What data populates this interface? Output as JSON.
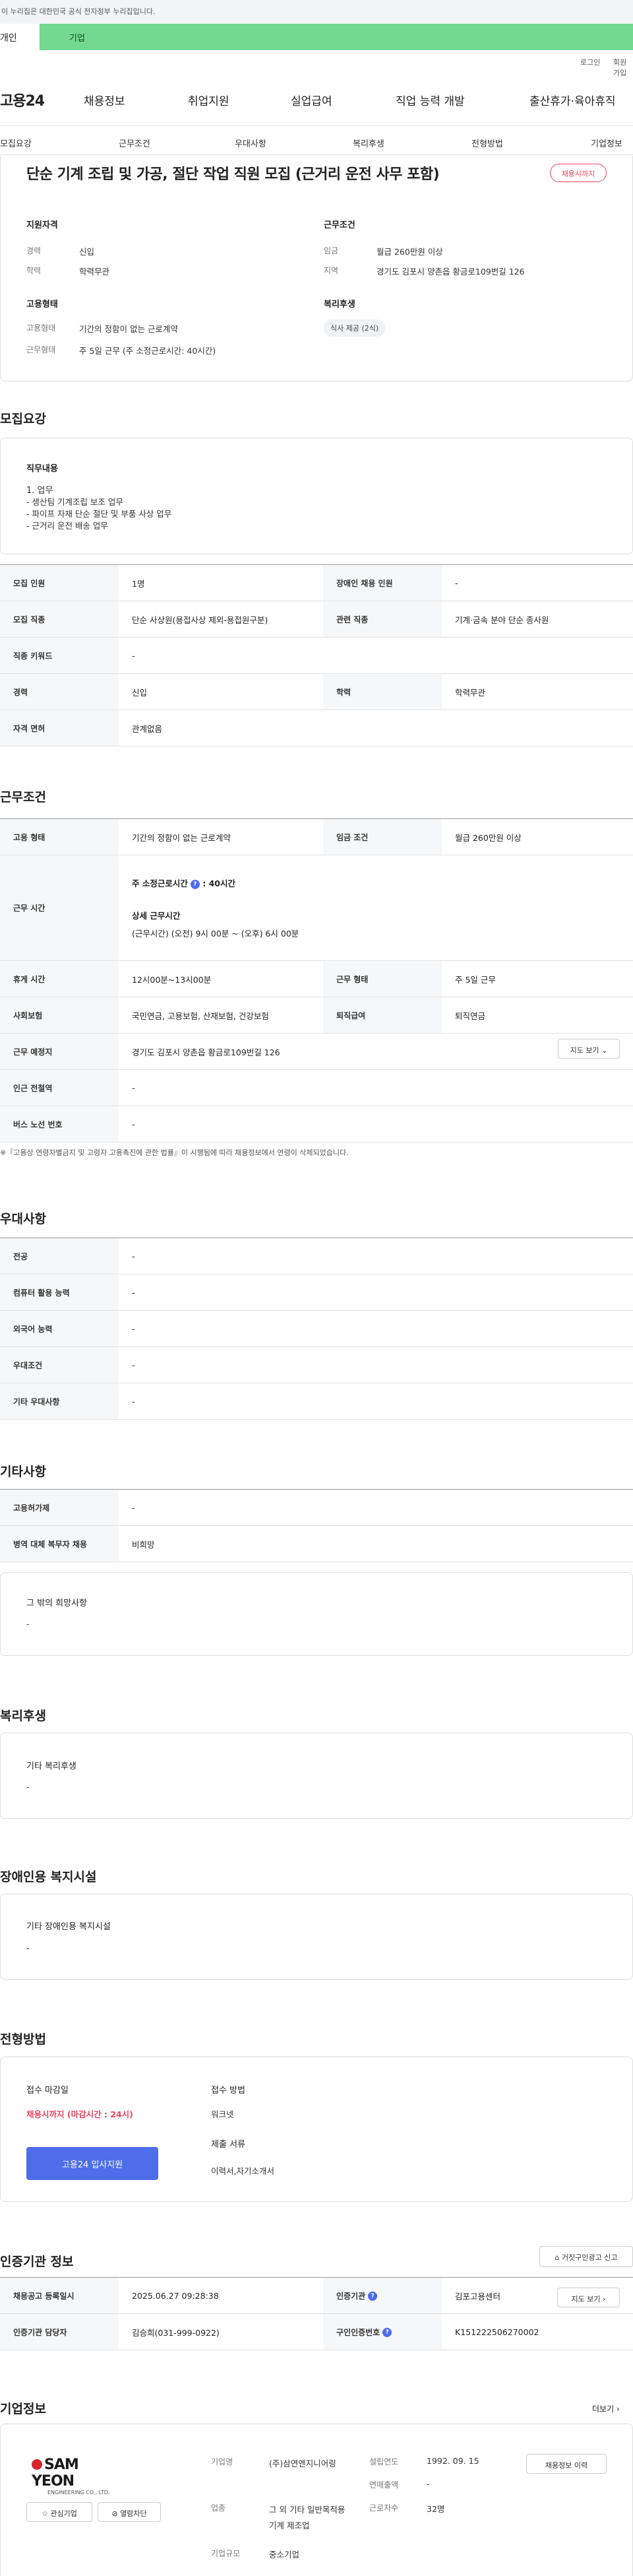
{
  "gov_banner": "이 누리집은 대한민국 공식 전자정부 누리집입니다.",
  "gov_bar": {
    "left": "개인",
    "right": "기업"
  },
  "util": {
    "login": "로그인",
    "join": "회원가입"
  },
  "logo": "고용24",
  "gnb": [
    "채용정보",
    "취업지원",
    "실업급여",
    "직업 능력 개발",
    "출산휴가·육아휴직"
  ],
  "subnav": [
    "모집요강",
    "근무조건",
    "우대사항",
    "복리후생",
    "전형방법",
    "기업정보"
  ],
  "title": "단순 기계 조립 및 가공, 절단 작업 직원 모집 (근거리 운전 사무 포함)",
  "badge": "채용시까지",
  "summary": {
    "qual_h": "지원자격",
    "exp_k": "경력",
    "exp_v": "신입",
    "edu_k": "학력",
    "edu_v": "학력무관",
    "cond_h": "근무조건",
    "wage_k": "임금",
    "wage_v": "월급 260만원 이상",
    "loc_k": "지역",
    "loc_v": "경기도 김포시 양촌읍 황금로109번길 126",
    "emp_h": "고용형태",
    "emptype_k": "고용형태",
    "emptype_v": "기간의 정함이 없는 근로계약",
    "work_k": "근무형태",
    "work_v": "주 5일 근무 (주 소정근로시간: 40시간)",
    "welfare_h": "복리후생",
    "welfare_tag": "식사 제공 (2식)"
  },
  "recruit": {
    "h": "모집요강",
    "duty_h": "직무내용",
    "duty_lines": [
      "1. 업무",
      "- 생산팀 기계조립 보조 업무",
      "- 파이프 자재 단순 절단 및 부품 사상 업무",
      "- 근거리 운전 배송 업무"
    ],
    "rows": [
      [
        "모집 인원",
        "1명",
        "장애인 채용 인원",
        "-"
      ],
      [
        "모집 직종",
        "단순 사상원(용접사상 제외-용접원구분)",
        "관련 직종",
        "기계·금속 분야 단순 종사원"
      ],
      [
        "직종 키워드",
        "-",
        "",
        ""
      ],
      [
        "경력",
        "신입",
        "학력",
        "학력무관"
      ],
      [
        "자격 면허",
        "관계없음",
        "",
        ""
      ]
    ]
  },
  "cond": {
    "h": "근무조건",
    "r1": [
      "고용 형태",
      "기간의 정함이 없는 근로계약",
      "임금 조건",
      "월급 260만원 이상"
    ],
    "time_k": "근무 시간",
    "time_l1": "주 소정근로시간",
    "time_v1": "40시간",
    "time_l2": "상세 근무시간",
    "time_v2": "(근무시간) (오전) 9시 00분 ~ (오후) 6시 00분",
    "r3": [
      "휴게 시간",
      "12시00분~13시00분",
      "근무 형태",
      "주 5일 근무"
    ],
    "r4": [
      "사회보험",
      "국민연금, 고용보험, 산재보험, 건강보험",
      "퇴직급여",
      "퇴직연금"
    ],
    "r5": [
      "근무 예정지",
      "경기도 김포시 양촌읍 황금로109번길 126"
    ],
    "map_btn": "지도 보기",
    "r6": [
      "인근 전철역",
      "-"
    ],
    "r7": [
      "버스 노선 번호",
      "-"
    ],
    "note": "※『고용상 연령차별금지 및 고령자 고용촉진에 관한 법률』이 시행됨에 따라 채용정보에서 연령이 삭제되었습니다."
  },
  "pref": {
    "h": "우대사항",
    "rows": [
      [
        "전공",
        "-"
      ],
      [
        "컴퓨터 활용 능력",
        "-"
      ],
      [
        "외국어 능력",
        "-"
      ],
      [
        "우대조건",
        "-"
      ],
      [
        "기타 우대사항",
        "-"
      ]
    ]
  },
  "etc": {
    "h": "기타사항",
    "rows": [
      [
        "고용허가제",
        "-"
      ],
      [
        "병역 대체 복무자 채용",
        "비희망"
      ]
    ],
    "box_h": "그 밖의 희망사항",
    "box_v": "-"
  },
  "welfare": {
    "h": "복리후생",
    "box_h": "기타 복리후생",
    "box_v": "-"
  },
  "disab": {
    "h": "장애인용 복지시설",
    "box_h": "기타 장애인용 복지시설",
    "box_v": "-"
  },
  "process": {
    "h": "전형방법",
    "deadline_h": "접수 마감일",
    "deadline_v": "채용시까지 (마감시간 : 24시)",
    "apply_btn": "고용24 입사지원",
    "method_h": "접수 방법",
    "method_v": "워크넷",
    "docs_h": "제출 서류",
    "docs_v": "이력서,자기소개서"
  },
  "cert": {
    "h": "인증기관 정보",
    "report_btn": "거짓구인광고 신고",
    "rows": [
      [
        "채용공고 등록일시",
        "2025.06.27 09:28:38",
        "인증기관",
        "김포고용센터"
      ],
      [
        "인증기관 담당자",
        "김승희(031-999-0922)",
        "구인인증번호",
        "K151222506270002"
      ]
    ],
    "map_btn": "지도 보기"
  },
  "company": {
    "h": "기업정보",
    "more": "더보기",
    "logo": "SAM YEON",
    "logo_sub": "ENGINEERING CO., LTD.",
    "fav": "관심기업",
    "block": "열람차단",
    "name_k": "기업명",
    "name_v": "(주)삼연엔지니어링",
    "biz_k": "업종",
    "biz_v": "그 외 기타 일반목적용 기계 제조업",
    "size_k": "기업규모",
    "size_v": "중소기업",
    "year_k": "설립연도",
    "year_v": "1992. 09. 15",
    "sales_k": "연매출액",
    "sales_v": "-",
    "emp_k": "근로자수",
    "emp_v": "32명",
    "jobs_btn": "채용정보 이력"
  },
  "colors": {
    "accent": "#4d6dea",
    "badge": "#e9455f",
    "gov_green": "#72d98e"
  }
}
